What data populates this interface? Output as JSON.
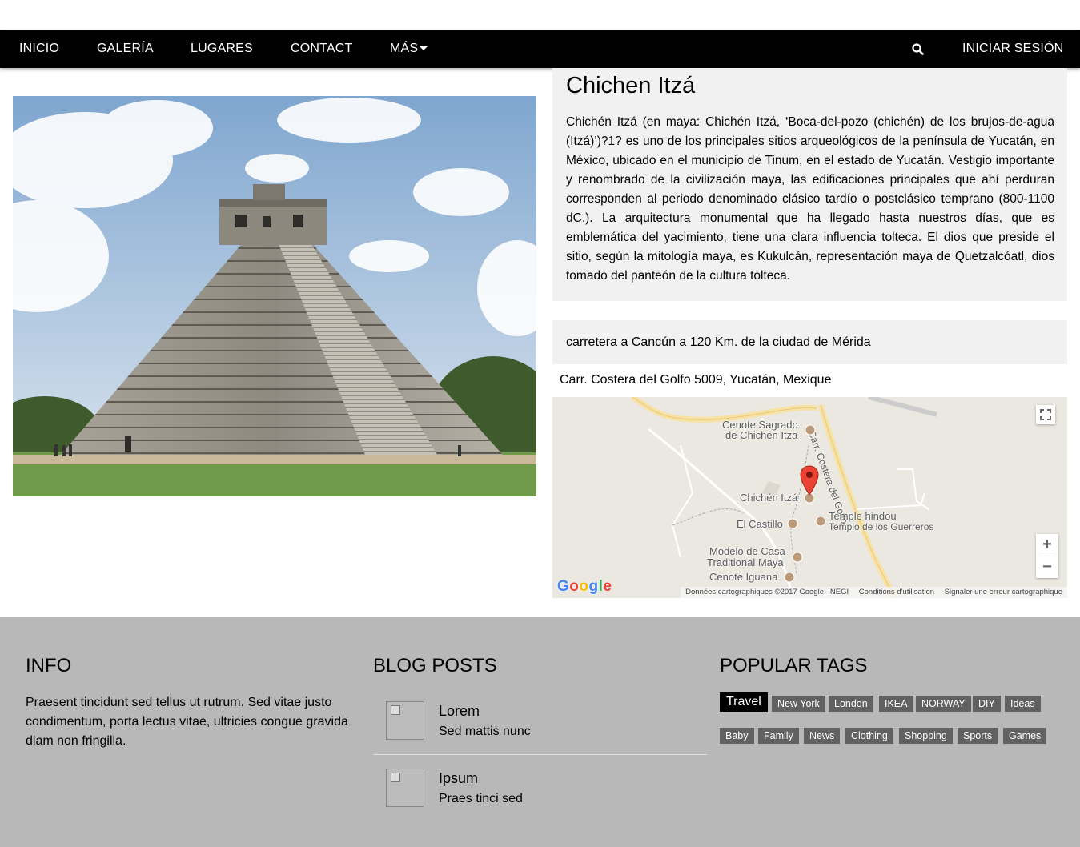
{
  "nav": {
    "items": [
      "INICIO",
      "GALERÍA",
      "LUGARES",
      "CONTACT"
    ],
    "more_label": "MÁS",
    "login_label": "INICIAR SESIÓN"
  },
  "place": {
    "title": "Chichen Itzá",
    "description": "Chichén Itzá (en maya: Chichén Itzá, ‘Boca-del-pozo (chichén) de los brujos-de-agua (Itzá)’)?1? es uno de los principales sitios arqueológicos de la península de Yucatán, en México, ubicado en el municipio de Tinum, en el estado de Yucatán. Vestigio importante y renombrado de la civilización maya, las edificaciones principales que ahí perduran corresponden al periodo denominado clásico tardío o postclásico temprano (800-1100 dC.). La arquitectura monumental que ha llegado hasta nuestros días, que es emblemática del yacimiento, tiene una clara influencia tolteca. El dios que preside el sitio, según la mitología maya, es Kukulcán, representación maya de Quetzalcóatl, dios tomado del panteón de la cultura tolteca.",
    "location": "carretera a Cancún a 120 Km. de la ciudad de Mérida",
    "address": "Carr. Costera del Golfo 5009, Yucatán, Mexique"
  },
  "map": {
    "labels": {
      "cenote_sagrado_1": "Cenote Sagrado",
      "cenote_sagrado_2": "de Chichen Itza",
      "road": "Carr. Costera del Golfo",
      "chichen": "Chichén Itzá",
      "temple_1": "Temple hindou",
      "temple_2": "Templo de los Guerreros",
      "castillo": "El Castillo",
      "modelo_1": "Modelo de Casa",
      "modelo_2": "Traditional Maya",
      "cenote_iguana": "Cenote Iguana"
    },
    "zoom_in": "+",
    "zoom_out": "−",
    "attribution": "Données cartographiques ©2017 Google, INEGI",
    "terms": "Conditions d'utilisation",
    "report": "Signaler une erreur cartographique",
    "logo": "Google"
  },
  "footer": {
    "info": {
      "title": "INFO",
      "text": "Praesent tincidunt sed tellus ut rutrum. Sed vitae justo condimentum, porta lectus vitae, ultricies congue gravida diam non fringilla."
    },
    "blog": {
      "title": "BLOG POSTS",
      "posts": [
        {
          "title": "Lorem",
          "subtitle": "Sed mattis nunc"
        },
        {
          "title": "Ipsum",
          "subtitle": "Praes tinci sed"
        }
      ]
    },
    "tags": {
      "title": "POPULAR TAGS",
      "items": [
        "Travel",
        "New York",
        "London",
        "IKEA",
        "NORWAY",
        "DIY",
        "Ideas",
        "Baby",
        "Family",
        "News",
        "Clothing",
        "Shopping",
        "Sports",
        "Games"
      ],
      "active": "Travel"
    }
  }
}
